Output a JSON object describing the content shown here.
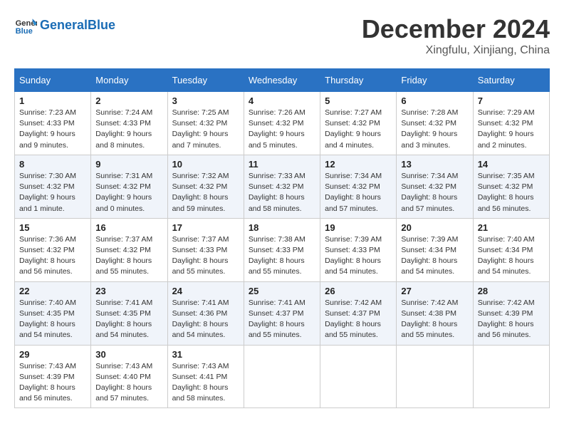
{
  "header": {
    "logo_general": "General",
    "logo_blue": "Blue",
    "month_title": "December 2024",
    "location": "Xingfulu, Xinjiang, China"
  },
  "weekdays": [
    "Sunday",
    "Monday",
    "Tuesday",
    "Wednesday",
    "Thursday",
    "Friday",
    "Saturday"
  ],
  "weeks": [
    [
      {
        "day": "1",
        "info": "Sunrise: 7:23 AM\nSunset: 4:33 PM\nDaylight: 9 hours\nand 9 minutes."
      },
      {
        "day": "2",
        "info": "Sunrise: 7:24 AM\nSunset: 4:33 PM\nDaylight: 9 hours\nand 8 minutes."
      },
      {
        "day": "3",
        "info": "Sunrise: 7:25 AM\nSunset: 4:32 PM\nDaylight: 9 hours\nand 7 minutes."
      },
      {
        "day": "4",
        "info": "Sunrise: 7:26 AM\nSunset: 4:32 PM\nDaylight: 9 hours\nand 5 minutes."
      },
      {
        "day": "5",
        "info": "Sunrise: 7:27 AM\nSunset: 4:32 PM\nDaylight: 9 hours\nand 4 minutes."
      },
      {
        "day": "6",
        "info": "Sunrise: 7:28 AM\nSunset: 4:32 PM\nDaylight: 9 hours\nand 3 minutes."
      },
      {
        "day": "7",
        "info": "Sunrise: 7:29 AM\nSunset: 4:32 PM\nDaylight: 9 hours\nand 2 minutes."
      }
    ],
    [
      {
        "day": "8",
        "info": "Sunrise: 7:30 AM\nSunset: 4:32 PM\nDaylight: 9 hours\nand 1 minute."
      },
      {
        "day": "9",
        "info": "Sunrise: 7:31 AM\nSunset: 4:32 PM\nDaylight: 9 hours\nand 0 minutes."
      },
      {
        "day": "10",
        "info": "Sunrise: 7:32 AM\nSunset: 4:32 PM\nDaylight: 8 hours\nand 59 minutes."
      },
      {
        "day": "11",
        "info": "Sunrise: 7:33 AM\nSunset: 4:32 PM\nDaylight: 8 hours\nand 58 minutes."
      },
      {
        "day": "12",
        "info": "Sunrise: 7:34 AM\nSunset: 4:32 PM\nDaylight: 8 hours\nand 57 minutes."
      },
      {
        "day": "13",
        "info": "Sunrise: 7:34 AM\nSunset: 4:32 PM\nDaylight: 8 hours\nand 57 minutes."
      },
      {
        "day": "14",
        "info": "Sunrise: 7:35 AM\nSunset: 4:32 PM\nDaylight: 8 hours\nand 56 minutes."
      }
    ],
    [
      {
        "day": "15",
        "info": "Sunrise: 7:36 AM\nSunset: 4:32 PM\nDaylight: 8 hours\nand 56 minutes."
      },
      {
        "day": "16",
        "info": "Sunrise: 7:37 AM\nSunset: 4:32 PM\nDaylight: 8 hours\nand 55 minutes."
      },
      {
        "day": "17",
        "info": "Sunrise: 7:37 AM\nSunset: 4:33 PM\nDaylight: 8 hours\nand 55 minutes."
      },
      {
        "day": "18",
        "info": "Sunrise: 7:38 AM\nSunset: 4:33 PM\nDaylight: 8 hours\nand 55 minutes."
      },
      {
        "day": "19",
        "info": "Sunrise: 7:39 AM\nSunset: 4:33 PM\nDaylight: 8 hours\nand 54 minutes."
      },
      {
        "day": "20",
        "info": "Sunrise: 7:39 AM\nSunset: 4:34 PM\nDaylight: 8 hours\nand 54 minutes."
      },
      {
        "day": "21",
        "info": "Sunrise: 7:40 AM\nSunset: 4:34 PM\nDaylight: 8 hours\nand 54 minutes."
      }
    ],
    [
      {
        "day": "22",
        "info": "Sunrise: 7:40 AM\nSunset: 4:35 PM\nDaylight: 8 hours\nand 54 minutes."
      },
      {
        "day": "23",
        "info": "Sunrise: 7:41 AM\nSunset: 4:35 PM\nDaylight: 8 hours\nand 54 minutes."
      },
      {
        "day": "24",
        "info": "Sunrise: 7:41 AM\nSunset: 4:36 PM\nDaylight: 8 hours\nand 54 minutes."
      },
      {
        "day": "25",
        "info": "Sunrise: 7:41 AM\nSunset: 4:37 PM\nDaylight: 8 hours\nand 55 minutes."
      },
      {
        "day": "26",
        "info": "Sunrise: 7:42 AM\nSunset: 4:37 PM\nDaylight: 8 hours\nand 55 minutes."
      },
      {
        "day": "27",
        "info": "Sunrise: 7:42 AM\nSunset: 4:38 PM\nDaylight: 8 hours\nand 55 minutes."
      },
      {
        "day": "28",
        "info": "Sunrise: 7:42 AM\nSunset: 4:39 PM\nDaylight: 8 hours\nand 56 minutes."
      }
    ],
    [
      {
        "day": "29",
        "info": "Sunrise: 7:43 AM\nSunset: 4:39 PM\nDaylight: 8 hours\nand 56 minutes."
      },
      {
        "day": "30",
        "info": "Sunrise: 7:43 AM\nSunset: 4:40 PM\nDaylight: 8 hours\nand 57 minutes."
      },
      {
        "day": "31",
        "info": "Sunrise: 7:43 AM\nSunset: 4:41 PM\nDaylight: 8 hours\nand 58 minutes."
      },
      {
        "day": "",
        "info": ""
      },
      {
        "day": "",
        "info": ""
      },
      {
        "day": "",
        "info": ""
      },
      {
        "day": "",
        "info": ""
      }
    ]
  ]
}
